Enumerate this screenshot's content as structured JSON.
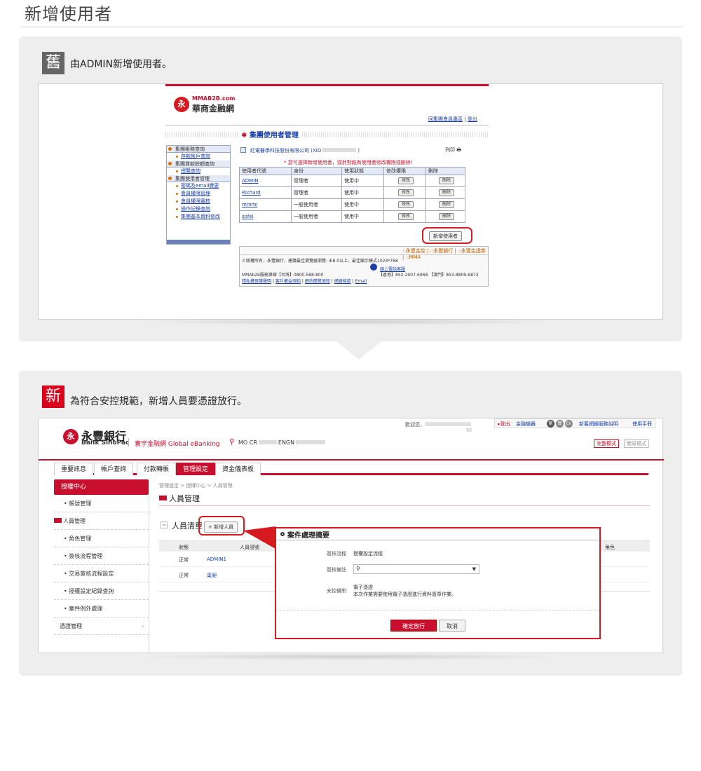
{
  "page_title": "新增使用者",
  "old": {
    "badge": "舊",
    "caption": "由ADMIN新增使用者。",
    "logo": {
      "mark": "永",
      "en": "MMAB2B.com",
      "zh": "華商金融網"
    },
    "top_links": [
      "回集團會員專區",
      "|",
      "登出"
    ],
    "section_title": "集團使用者管理",
    "sidebar": {
      "groups": [
        {
          "title": "集團帳務查詢",
          "items": [
            "存款帳戶查詢"
          ]
        },
        {
          "title": "集團貸款餘額查詢",
          "items": [
            "總覽查詢"
          ]
        },
        {
          "title": "集團使用者管理",
          "items": [
            "密碼及email變更",
            "會員權限管理",
            "會員權限審核",
            "操作記錄查詢",
            "集團基本資料修改"
          ]
        }
      ]
    },
    "company": "紅電醫學科技股份有限公司 (XID",
    "company_end": ")",
    "print_label": "列印",
    "notice": "* 您可選擇新增使用者，或針對既有使用者修改權限或刪除!",
    "table_headers": [
      "使用者代號",
      "身份",
      "使用狀態",
      "修改權限",
      "刪除"
    ],
    "rows": [
      [
        "ADMIN",
        "管理者",
        "使用中",
        "修改",
        "刪除"
      ],
      [
        "Richard",
        "管理者",
        "使用中",
        "修改",
        "刪除"
      ],
      [
        "mmmi",
        "一般使用者",
        "使用中",
        "修改",
        "刪除"
      ],
      [
        "sofei",
        "一般使用者",
        "使用中",
        "修改",
        "刪除"
      ]
    ],
    "add_button": "新增使用者",
    "footer_tabs": [
      "::永豐金控",
      "::永豐銀行",
      "::永豐金證券",
      "::MMA"
    ],
    "copyright": "©版權所有，永豐銀行，建議最佳瀏覽器瀏覽: IE8.0以上，最佳顯示模式1024*768",
    "service_label": "線上電話客服",
    "hotline": "MMAb2b服務專線【台灣】0800-588-800",
    "hotline2": "【香港】852-2907-6968 【澳門】853-8809-6873",
    "footer_links": [
      "隱私權保護聲明",
      "|",
      "客戶權益須知",
      "|",
      "網站閱覽須知",
      "|",
      "網絡條款",
      "|",
      "Email"
    ]
  },
  "new": {
    "badge": "新",
    "caption": "為符合安控規範，新增人員要憑證放行。",
    "logo": {
      "mark": "永",
      "zh": "永豐銀行",
      "en": "Bank SinoPac"
    },
    "brand": "寰宇金融網 Global eBanking",
    "user_prefix": "MO CR",
    "user_mid": "ENGN",
    "welcome": "歡迎您，",
    "top_links": [
      "▸登出",
      "金融機器",
      "新舊網銀服務說明",
      "使用手冊"
    ],
    "round_icons": [
      "繁",
      "簡",
      "En"
    ],
    "mode_buttons": [
      "完整模式",
      "簡易模式"
    ],
    "tabs": [
      "重要訊息",
      "帳戶查詢",
      "付款轉帳",
      "管理設定",
      "資金儀表板"
    ],
    "sidebar_title": "授權中心",
    "sidebar_items": [
      "帳號管理",
      "人員管理",
      "角色管理",
      "簽核流程管理",
      "交易簽核流程設定",
      "授權設定紀錄查詢",
      "案件例外處理",
      "憑證管理"
    ],
    "breadcrumb": "管理設定 > 授權中心 > 人員管理",
    "page_heading": "人員管理",
    "list_heading": "人員清單",
    "add_button": "+ 新增人員",
    "table_headers": [
      "狀態",
      "人員證號",
      "角色"
    ],
    "rows": [
      [
        "正常",
        "ADMIN1"
      ],
      [
        "正常",
        "葉昶"
      ]
    ],
    "modal": {
      "title": "案件處理摘要",
      "row1_label": "簽核流程",
      "row1_value": "授權設定流程",
      "row2_label": "簽核備註",
      "row3_label": "安控機制",
      "row3_value": "電子憑證",
      "row3_note": "本次作業需要使用電子憑證進行資料簽章作業。",
      "ok": "確定放行",
      "cancel": "取消"
    }
  }
}
